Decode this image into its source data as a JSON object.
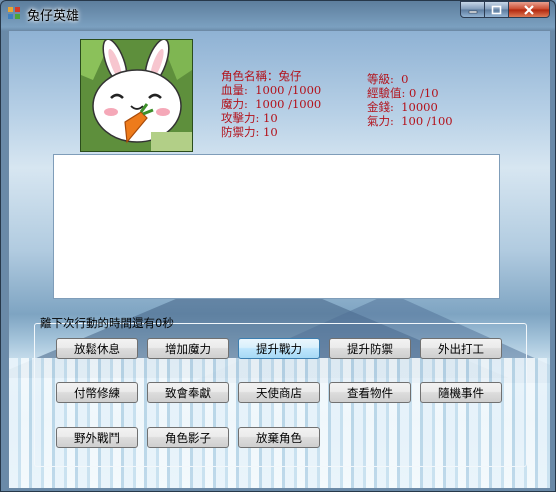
{
  "window": {
    "title": "兔仔英雄"
  },
  "character": {
    "name_label": "角色名稱：兔仔",
    "hp_label": "血量:  1000 /1000",
    "mp_label": "魔力:  1000 /1000",
    "attack_label": "攻擊力: 10",
    "defense_label": "防禦力: 10",
    "level_label": "等級:  0",
    "exp_label": "經驗值: 0 /10",
    "money_label": "金錢:  10000",
    "stamina_label": "氣力:  100 /100"
  },
  "actions": {
    "timer_label": "離下次行動的時間還有0秒",
    "buttons": [
      "放鬆休息",
      "增加魔力",
      "提升戰力",
      "提升防禦",
      "外出打工",
      "付幣修練",
      "致會奉獻",
      "天使商店",
      "查看物件",
      "隨機事件",
      "野外戰鬥",
      "角色影子",
      "放棄角色"
    ]
  },
  "colors": {
    "stat_text": "#b3121b",
    "log_border": "#7f9db9"
  }
}
